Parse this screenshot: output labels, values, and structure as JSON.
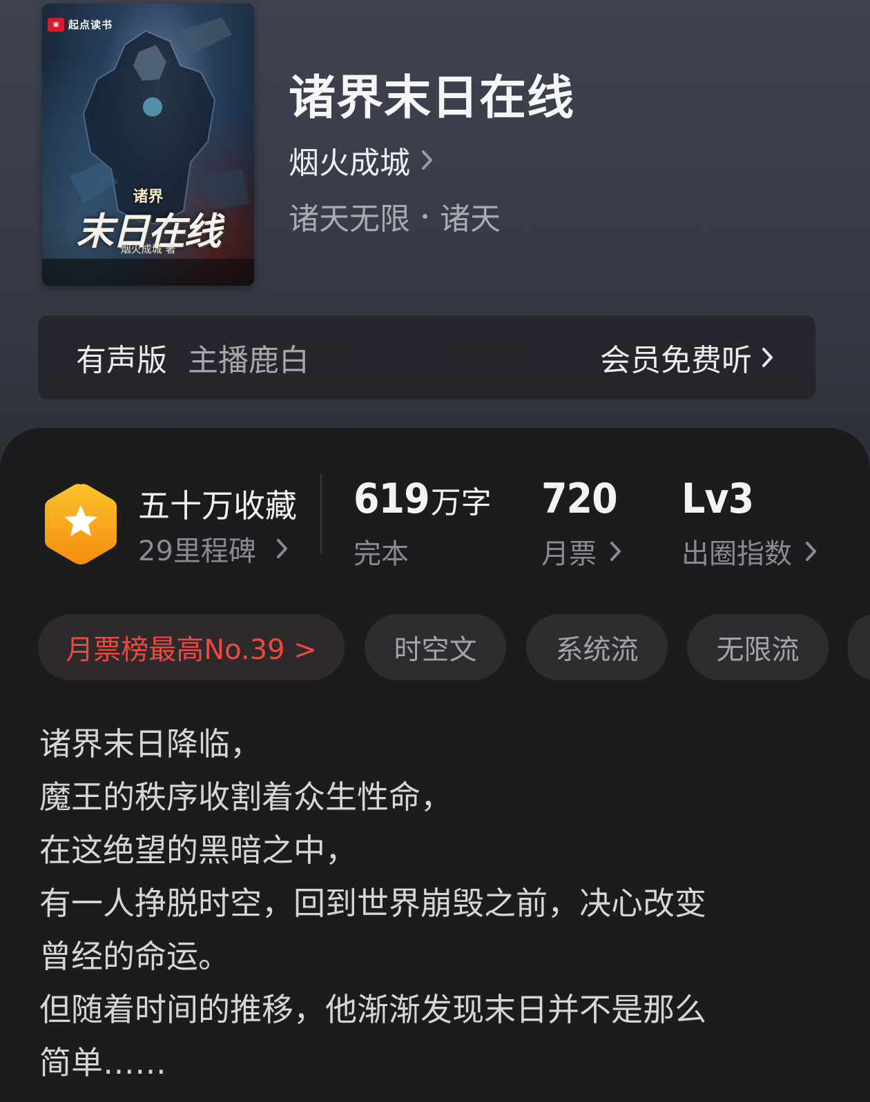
{
  "book": {
    "title": "诸界末日在线",
    "author": "烟火成城",
    "genre": "诸天无限",
    "subgenre": "诸天",
    "cover": {
      "publisher": "起点读书",
      "title_small": "诸界",
      "title_big": "末日在线",
      "author_line": "烟火成城 著"
    }
  },
  "audio": {
    "label": "有声版",
    "host": "主播鹿白",
    "action": "会员免费听"
  },
  "stats": {
    "collections": "五十万收藏",
    "milestones": "29里程碑",
    "word_count": "619",
    "word_unit": "万字",
    "status": "完本",
    "monthly_votes": "720",
    "monthly_votes_label": "月票",
    "level": "Lv3",
    "level_label": "出圈指数"
  },
  "tags": [
    {
      "label": "月票榜最高No.39 >"
    },
    {
      "label": "时空文"
    },
    {
      "label": "系统流"
    },
    {
      "label": "无限流"
    }
  ],
  "colors": {
    "accent_red": "#f0483f",
    "badge_orange": "#f7a81c",
    "panel_bg": "#1c1c1e"
  },
  "description": [
    "诸界末日降临，",
    "魔王的秩序收割着众生性命，",
    "在这绝望的黑暗之中，",
    "有一人挣脱时空，回到世界崩毁之前，决心改变",
    "曾经的命运。",
    "但随着时间的推移，他渐渐发现末日并不是那么",
    "简单……"
  ]
}
